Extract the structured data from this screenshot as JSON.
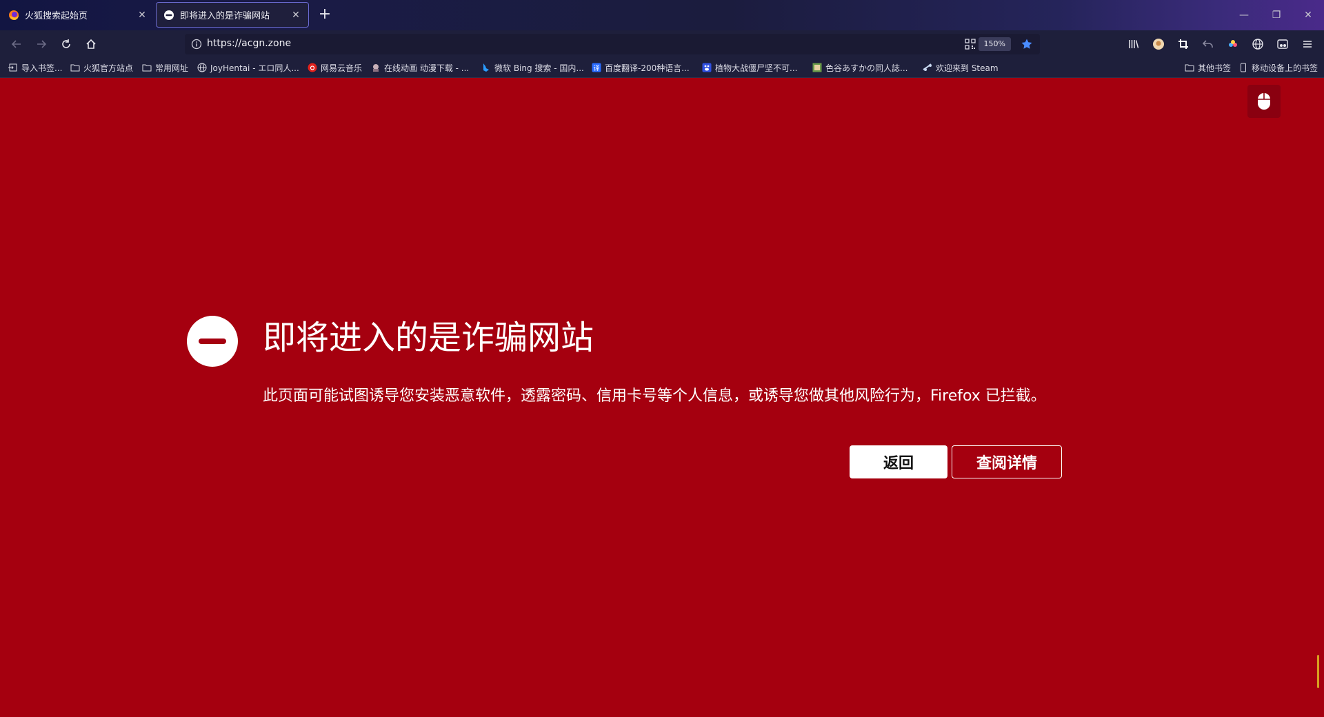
{
  "tabs": [
    {
      "title": "火狐搜索起始页",
      "active": false
    },
    {
      "title": "即将进入的是诈骗网站",
      "active": true
    }
  ],
  "newtab_label": "+",
  "window_controls": {
    "minimize": "—",
    "restore": "❐",
    "close": "✕"
  },
  "url": "https://acgn.zone",
  "zoom": "150%",
  "bookmarks": [
    {
      "label": "导入书签...",
      "icon": "import-icon"
    },
    {
      "label": "火狐官方站点",
      "icon": "folder-icon"
    },
    {
      "label": "常用网址",
      "icon": "folder-icon"
    },
    {
      "label": "JoyHentai - エロ同人...",
      "icon": "globe-icon"
    },
    {
      "label": "网易云音乐",
      "icon": "netease-icon"
    },
    {
      "label": "在线动画 动漫下载 - ...",
      "icon": "anime-icon"
    },
    {
      "label": "微软 Bing 搜索 - 国内...",
      "icon": "bing-icon"
    },
    {
      "label": "百度翻译-200种语言...",
      "icon": "baidu-translate-icon"
    },
    {
      "label": "植物大战僵尸坚不可...",
      "icon": "baidu-icon"
    },
    {
      "label": "色谷あすかの同人誌...",
      "icon": "site-icon"
    },
    {
      "label": "欢迎来到 Steam",
      "icon": "steam-icon"
    }
  ],
  "bookmarks_right": [
    {
      "label": "其他书签",
      "icon": "folder-icon"
    },
    {
      "label": "移动设备上的书签",
      "icon": "mobile-icon"
    }
  ],
  "page": {
    "title": "即将进入的是诈骗网站",
    "description": "此页面可能试图诱导您安装恶意软件，透露密码、信用卡号等个人信息，或诱导您做其他风险行为，Firefox 已拦截。",
    "back_button": "返回",
    "details_button": "查阅详情"
  },
  "colors": {
    "page_background": "#a5000f",
    "chrome_background": "#1e1f3b",
    "accent": "#6a6ad0"
  }
}
